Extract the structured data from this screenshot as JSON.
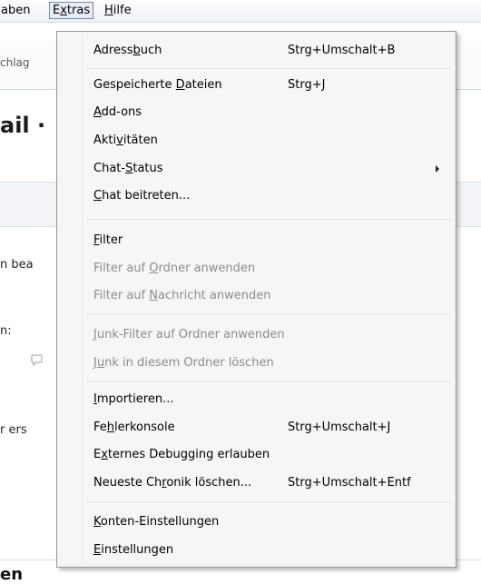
{
  "menubar": {
    "items": [
      {
        "pre": "",
        "u": "",
        "post": "aben"
      },
      {
        "pre": "E",
        "u": "x",
        "post": "tras"
      },
      {
        "pre": "",
        "u": "H",
        "post": "ilfe"
      }
    ]
  },
  "background": {
    "tab_text": "chlag",
    "title": "ail ·",
    "text1": "n bea",
    "text2": "n:",
    "text3": "r ers",
    "bottom": "en"
  },
  "menu": {
    "items": [
      {
        "id": "adressbuch",
        "pre": "Adress",
        "u": "b",
        "post": "uch",
        "shortcut": "Strg+Umschalt+B",
        "disabled": false
      },
      {
        "id": "gespeicherte-dateien",
        "pre": "Gespeicherte ",
        "u": "D",
        "post": "ateien",
        "shortcut": "Strg+J",
        "disabled": false
      },
      {
        "id": "add-ons",
        "pre": "",
        "u": "A",
        "post": "dd-ons",
        "shortcut": "",
        "disabled": false
      },
      {
        "id": "aktivitaeten",
        "pre": "Akti",
        "u": "v",
        "post": "itäten",
        "shortcut": "",
        "disabled": false
      },
      {
        "id": "chat-status",
        "pre": "Chat-",
        "u": "S",
        "post": "tatus",
        "shortcut": "",
        "disabled": false,
        "submenu": true
      },
      {
        "id": "chat-beitreten",
        "pre": "",
        "u": "C",
        "post": "hat beitreten...",
        "shortcut": "",
        "disabled": false
      },
      {
        "id": "filter",
        "pre": "",
        "u": "F",
        "post": "ilter",
        "shortcut": "",
        "disabled": false
      },
      {
        "id": "filter-ordner",
        "pre": "Filter auf ",
        "u": "O",
        "post": "rdner anwenden",
        "shortcut": "",
        "disabled": true
      },
      {
        "id": "filter-nachricht",
        "pre": "Filter auf ",
        "u": "N",
        "post": "achricht anwenden",
        "shortcut": "",
        "disabled": true
      },
      {
        "id": "junk-filter-ordner",
        "pre": "",
        "u": "J",
        "post": "unk-Filter auf Ordner anwenden",
        "shortcut": "",
        "disabled": true
      },
      {
        "id": "junk-loeschen",
        "pre": "J",
        "u": "u",
        "post": "nk in diesem Ordner löschen",
        "shortcut": "",
        "disabled": true
      },
      {
        "id": "importieren",
        "pre": "",
        "u": "I",
        "post": "mportieren...",
        "shortcut": "",
        "disabled": false
      },
      {
        "id": "fehlerkonsole",
        "pre": "Fe",
        "u": "h",
        "post": "lerkonsole",
        "shortcut": "Strg+Umschalt+J",
        "disabled": false
      },
      {
        "id": "externes-debugging",
        "pre": "E",
        "u": "x",
        "post": "ternes Debugging erlauben",
        "shortcut": "",
        "disabled": false
      },
      {
        "id": "chronik-loeschen",
        "pre": "Neueste Ch",
        "u": "r",
        "post": "onik löschen...",
        "shortcut": "Strg+Umschalt+Entf",
        "disabled": false
      },
      {
        "id": "konten-einstellungen",
        "pre": "",
        "u": "K",
        "post": "onten-Einstellungen",
        "shortcut": "",
        "disabled": false
      },
      {
        "id": "einstellungen",
        "pre": "",
        "u": "E",
        "post": "instellungen",
        "shortcut": "",
        "disabled": false
      }
    ]
  }
}
